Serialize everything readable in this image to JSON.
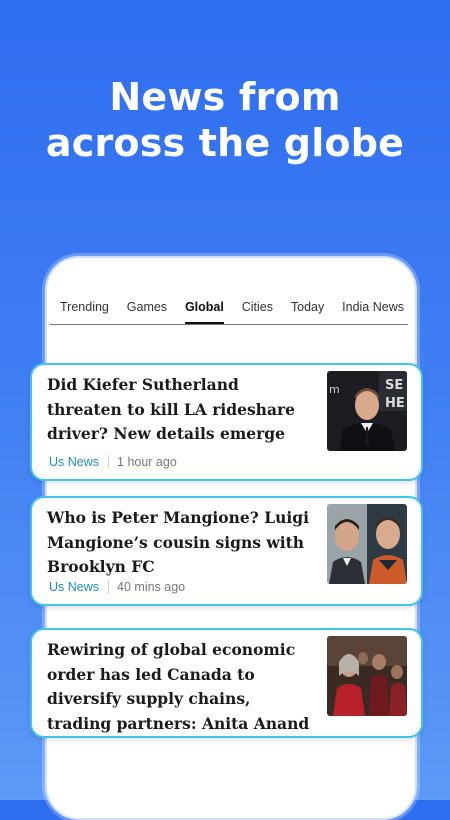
{
  "hero": {
    "line1": "News from",
    "line2": "across the globe"
  },
  "tabs": [
    {
      "label": "Trending",
      "active": false
    },
    {
      "label": "Games",
      "active": false
    },
    {
      "label": "Global",
      "active": true
    },
    {
      "label": "Cities",
      "active": false
    },
    {
      "label": "Today",
      "active": false
    },
    {
      "label": "India News",
      "active": false
    }
  ],
  "articles": [
    {
      "headline": "Did Kiefer Sutherland threaten to kill LA rideshare driver? New details emerge",
      "category": "Us News",
      "time": "1 hour ago"
    },
    {
      "headline": "Who is Peter Mangione? Luigi Mangione’s cousin signs with Brooklyn FC",
      "category": "Us News",
      "time": "40 mins ago"
    },
    {
      "headline": "Rewiring of global economic order has led Canada to diversify supply chains, trading partners: Anita Anand",
      "category": "",
      "time": ""
    }
  ],
  "colors": {
    "accent": "#42c3ee",
    "category": "#1f8fb8",
    "background": "#2f6df0"
  }
}
